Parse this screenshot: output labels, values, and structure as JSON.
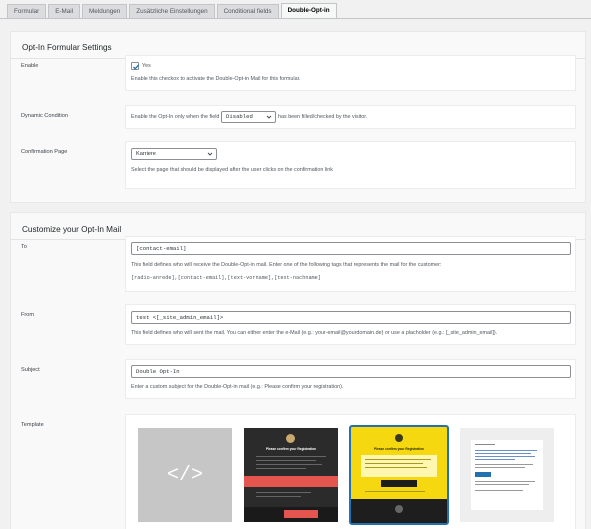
{
  "tabs": [
    {
      "label": "Formular"
    },
    {
      "label": "E-Mail"
    },
    {
      "label": "Meldungen"
    },
    {
      "label": "Zusätzliche Einstellungen"
    },
    {
      "label": "Conditional fields"
    },
    {
      "label": "Double-Opt-in"
    }
  ],
  "settings": {
    "title": "Opt-In Formular Settings",
    "enable": {
      "label": "Enable",
      "checkbox_label": "Yes",
      "checked": true,
      "description": "Enable this checkox to activate the Double-Opt-in Mail for this formular."
    },
    "dynamic_condition": {
      "label": "Dynamic Condition",
      "text_before": "Enable the Opt-In only when the field",
      "select_value": "Disabled",
      "text_after": "has been filled/checked by the visitor."
    },
    "confirmation_page": {
      "label": "Confirmation Page",
      "select_value": "Karriere",
      "description": "Select the page that should be displayed after the user clicks on the confirmation link"
    }
  },
  "mail": {
    "title": "Customize your Opt-In Mail",
    "to": {
      "label": "To",
      "value": "[contact-email]",
      "description": "This field defines who will receive the Double-Opt-in mail. Enter one of the following tags that represents the mail for the customer:",
      "tags": "[radio-anrede],[contact-email],[text-vorname],[text-nachname]"
    },
    "from": {
      "label": "From",
      "value": "test <[_site_admin_email]>",
      "description": "This field defines who will sent the mail. You can either enter the e-Mail (e.g.: your-email@yourdomain.de) or use a placholder (e.g.: [_site_admin_email])."
    },
    "subject": {
      "label": "Subject",
      "value": "Double Opt-In",
      "description": "Enter a custom subject for the Double-Opt-in mail (e.g.: Please confirm your registration)."
    },
    "template": {
      "label": "Template",
      "code_symbol": "</>",
      "preview_heading": "Please confirm your Registration",
      "selected": "yellow"
    }
  },
  "colors": {
    "accent": "#2271b1",
    "yellow_template": "#f5d80f",
    "dark_template": "#2b2b2b",
    "red_button": "#e5554f"
  }
}
